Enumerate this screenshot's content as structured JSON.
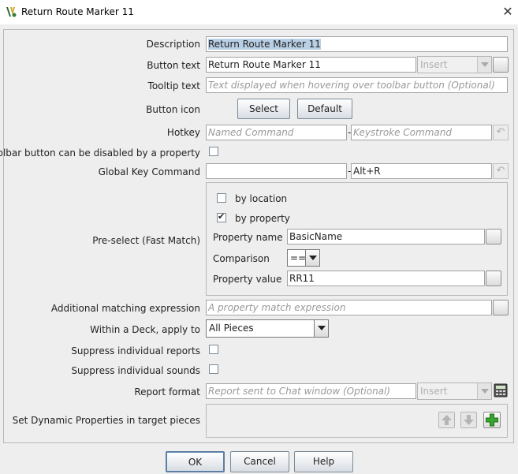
{
  "window": {
    "title": "Return Route Marker 11",
    "close_glyph": "✕"
  },
  "labels": {
    "description": "Description",
    "button_text": "Button text",
    "tooltip_text": "Tooltip text",
    "button_icon": "Button icon",
    "hotkey": "Hotkey",
    "toolbar_disable": "Toolbar button can be disabled by a property",
    "global_key_command": "Global Key Command",
    "preselect": "Pre-select (Fast Match)",
    "by_location": "by location",
    "by_property": "by property",
    "property_name": "Property name",
    "comparison": "Comparison",
    "property_value": "Property value",
    "additional_matching": "Additional matching expression",
    "within_deck": "Within a Deck, apply to",
    "suppress_reports": "Suppress individual reports",
    "suppress_sounds": "Suppress individual sounds",
    "report_format": "Report format",
    "set_dynamic": "Set Dynamic Properties in target pieces"
  },
  "fields": {
    "description": "Return Route Marker 11",
    "button_text": "Return Route Marker 11",
    "button_text_insert": "Insert",
    "tooltip_placeholder": "Text displayed when hovering over toolbar button (Optional)",
    "hotkey_named_placeholder": "Named Command",
    "hotkey_keystroke_placeholder": "Keystroke Command",
    "global_named": "",
    "global_keystroke": "Alt+R",
    "dash": "-",
    "property_name": "BasicName",
    "comparison": "==",
    "property_value": "RR11",
    "additional_placeholder": "A property match expression",
    "within_deck": "All Pieces",
    "report_placeholder": "Report sent to Chat window (Optional)",
    "report_insert": "Insert"
  },
  "checks": {
    "toolbar_disable": false,
    "by_location": false,
    "by_property": true,
    "suppress_reports": false,
    "suppress_sounds": false
  },
  "buttons": {
    "select": "Select",
    "default": "Default",
    "ok": "OK",
    "cancel": "Cancel",
    "help": "Help"
  },
  "icons": {
    "app": "vassal-icon",
    "undo": "undo-arrow-icon",
    "calculator": "calculator-icon",
    "up": "arrow-up-icon",
    "down": "arrow-down-icon",
    "add": "plus-icon"
  },
  "colors": {
    "selection": "#b8cfe5",
    "add_green": "#3aa530"
  }
}
